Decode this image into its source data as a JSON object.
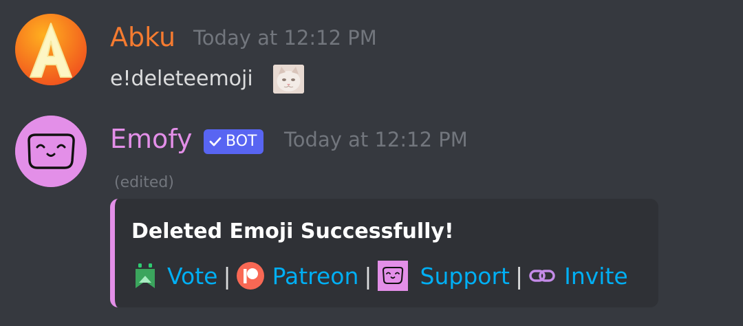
{
  "messages": [
    {
      "author": "Abku",
      "author_color": "#f57b30",
      "avatar_letter": "A",
      "timestamp": "Today at 12:12 PM",
      "content": "e!deleteemoji",
      "attached_emoji": "cat-emoji"
    },
    {
      "author": "Emofy",
      "author_color": "#e38fe8",
      "bot_tag": "BOT",
      "timestamp": "Today at 12:12 PM",
      "edited": "(edited)",
      "embed": {
        "accent_color": "#e38fe8",
        "title": "Deleted Emoji Successfully!",
        "links": [
          {
            "label": "Vote",
            "icon": "topgg-icon"
          },
          {
            "label": "Patreon",
            "icon": "patreon-icon"
          },
          {
            "label": "Support",
            "icon": "emofy-icon"
          },
          {
            "label": "Invite",
            "icon": "link-icon"
          }
        ],
        "separator": "|",
        "link_color": "#00aff4"
      }
    }
  ]
}
